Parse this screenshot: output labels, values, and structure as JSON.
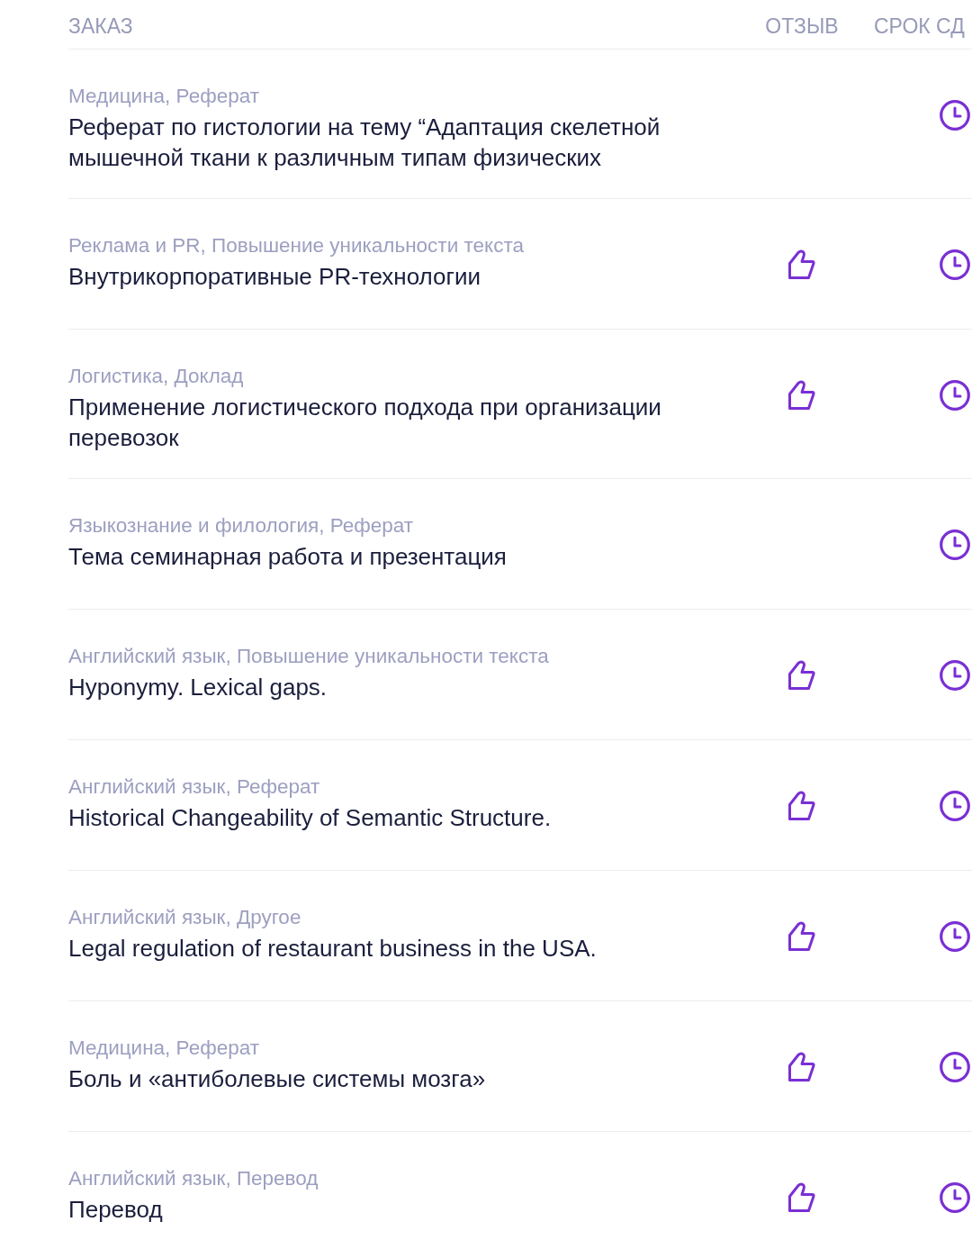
{
  "table": {
    "columns": [
      "ЗАКАЗ",
      "ОТЗЫВ",
      "СРОК СД"
    ],
    "rows": [
      {
        "category": "Медицина, Реферат",
        "title": "Реферат по гистологии на тему “Адаптация скелетной мышечной ткани к различным типам физических",
        "review": false
      },
      {
        "category": "Реклама и PR, Повышение уникальности текста",
        "title": "Внутрикорпоративные PR-технологии",
        "review": true
      },
      {
        "category": "Логистика, Доклад",
        "title": "Применение логистического подхода при организации перевозок",
        "review": true
      },
      {
        "category": "Языкознание и филология, Реферат",
        "title": "Тема семинарная работа и презентация",
        "review": false
      },
      {
        "category": "Английский язык, Повышение уникальности текста",
        "title": "Hyponymy. Lexical gaps.",
        "review": true
      },
      {
        "category": "Английский язык, Реферат",
        "title": "Historical Changeability of Semantic Structure.",
        "review": true
      },
      {
        "category": "Английский язык, Другое",
        "title": "Legal regulation of restaurant business in the USA.",
        "review": true
      },
      {
        "category": "Медицина, Реферат",
        "title": "Боль и «антиболевые системы мозга»",
        "review": true
      },
      {
        "category": "Английский язык, Перевод",
        "title": "Перевод",
        "review": true
      }
    ]
  }
}
